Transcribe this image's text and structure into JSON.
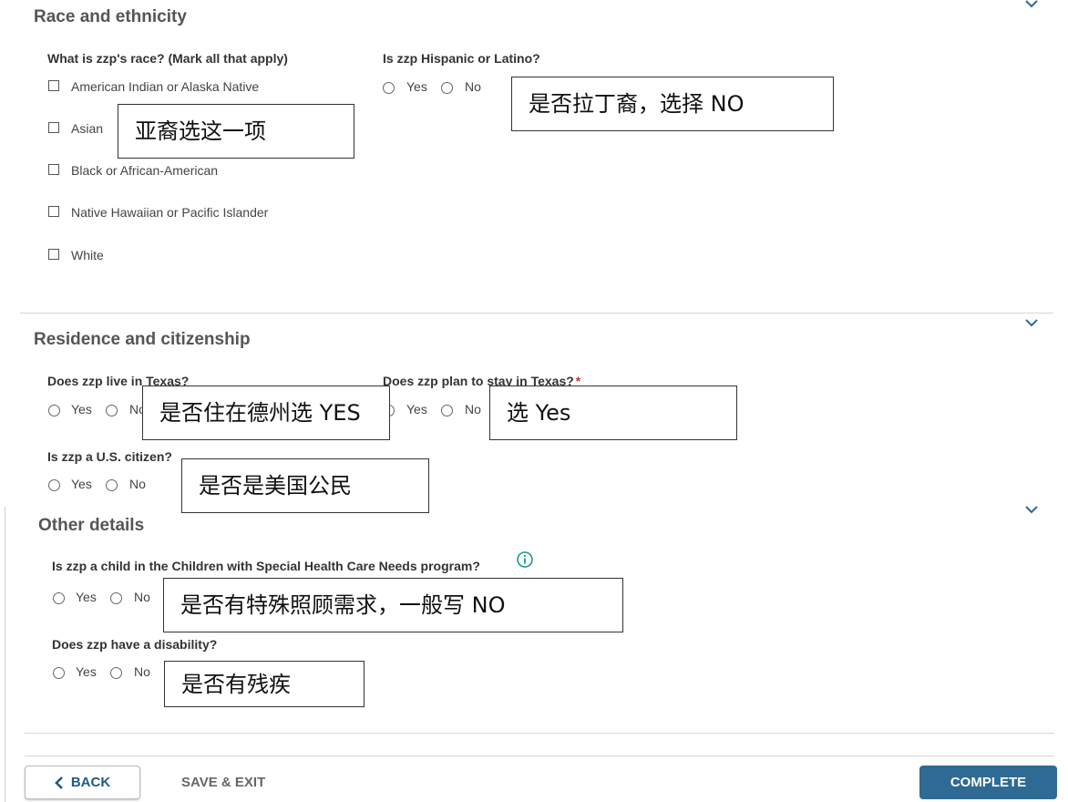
{
  "race_section": {
    "title": "Race and ethnicity",
    "race_question": "What is zzp's race? (Mark all that apply)",
    "race_options": [
      "American Indian or Alaska Native",
      "Asian",
      "Black or African-American",
      "Native Hawaiian or Pacific Islander",
      "White"
    ],
    "hispanic_question": "Is zzp Hispanic or Latino?",
    "yes_label": "Yes",
    "no_label": "No"
  },
  "residence_section": {
    "title": "Residence and citizenship",
    "live_texas_question": "Does zzp live in Texas?",
    "stay_texas_question": "Does zzp plan to stay in Texas?",
    "required_mark": "*",
    "citizen_question": "Is zzp a U.S. citizen?",
    "yes_label": "Yes",
    "no_label": "No"
  },
  "other_section": {
    "title": "Other details",
    "special_needs_question": "Is zzp a child in the Children with Special Health Care Needs program?",
    "disability_question": "Does zzp have a disability?",
    "yes_label": "Yes",
    "no_label": "No"
  },
  "annotations": {
    "asian": "亚裔选这一项",
    "hispanic": "是否拉丁裔，选择 NO",
    "live_texas": "是否住在德州选 YES",
    "stay_texas": "选 Yes",
    "citizen": "是否是美国公民",
    "special_needs": "是否有特殊照顾需求，一般写 NO",
    "disability": "是否有残疾"
  },
  "footer": {
    "back_label": "BACK",
    "save_exit_label": "SAVE & EXIT",
    "complete_label": "COMPLETE"
  },
  "icons": {
    "chevron": "chevron-down-icon",
    "info": "info-icon",
    "back": "chevron-left-icon"
  },
  "colors": {
    "accent": "#2e6a93",
    "link_blue": "#1f5b84",
    "info_green": "#1a9a8a",
    "required": "#c0392b"
  }
}
